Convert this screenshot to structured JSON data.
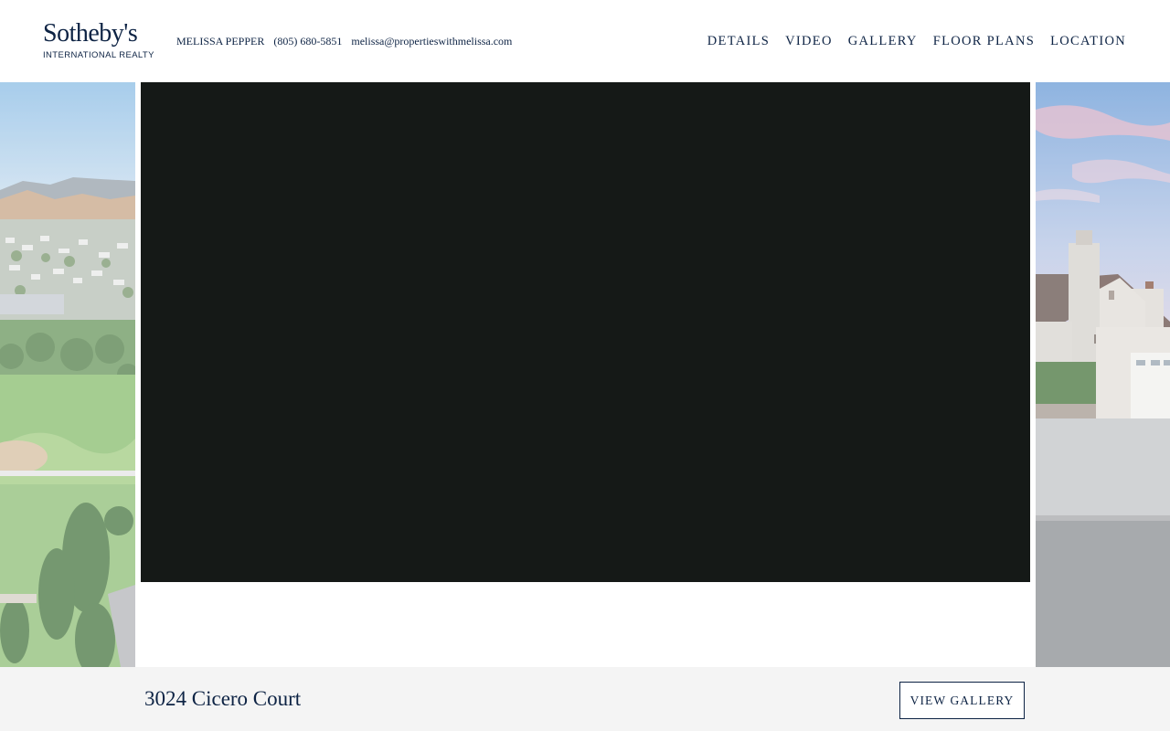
{
  "brand": {
    "name": "Sotheby's",
    "subtitle": "INTERNATIONAL REALTY",
    "color": "#0d2344"
  },
  "agent": {
    "name": "MELISSA PEPPER",
    "phone": "(805) 680-5851",
    "email": "melissa@propertieswithmelissa.com"
  },
  "nav": {
    "items": [
      {
        "label": "DETAILS"
      },
      {
        "label": "VIDEO"
      },
      {
        "label": "GALLERY"
      },
      {
        "label": "FLOOR PLANS"
      },
      {
        "label": "LOCATION"
      }
    ]
  },
  "hero": {
    "left_photo": "aerial-neighborhood-park-photo",
    "right_photo": "house-garage-exterior-photo",
    "video_background": "#151917"
  },
  "footer": {
    "address": "3024 Cicero Court",
    "view_gallery_label": "VIEW GALLERY",
    "background": "#f4f4f4"
  }
}
